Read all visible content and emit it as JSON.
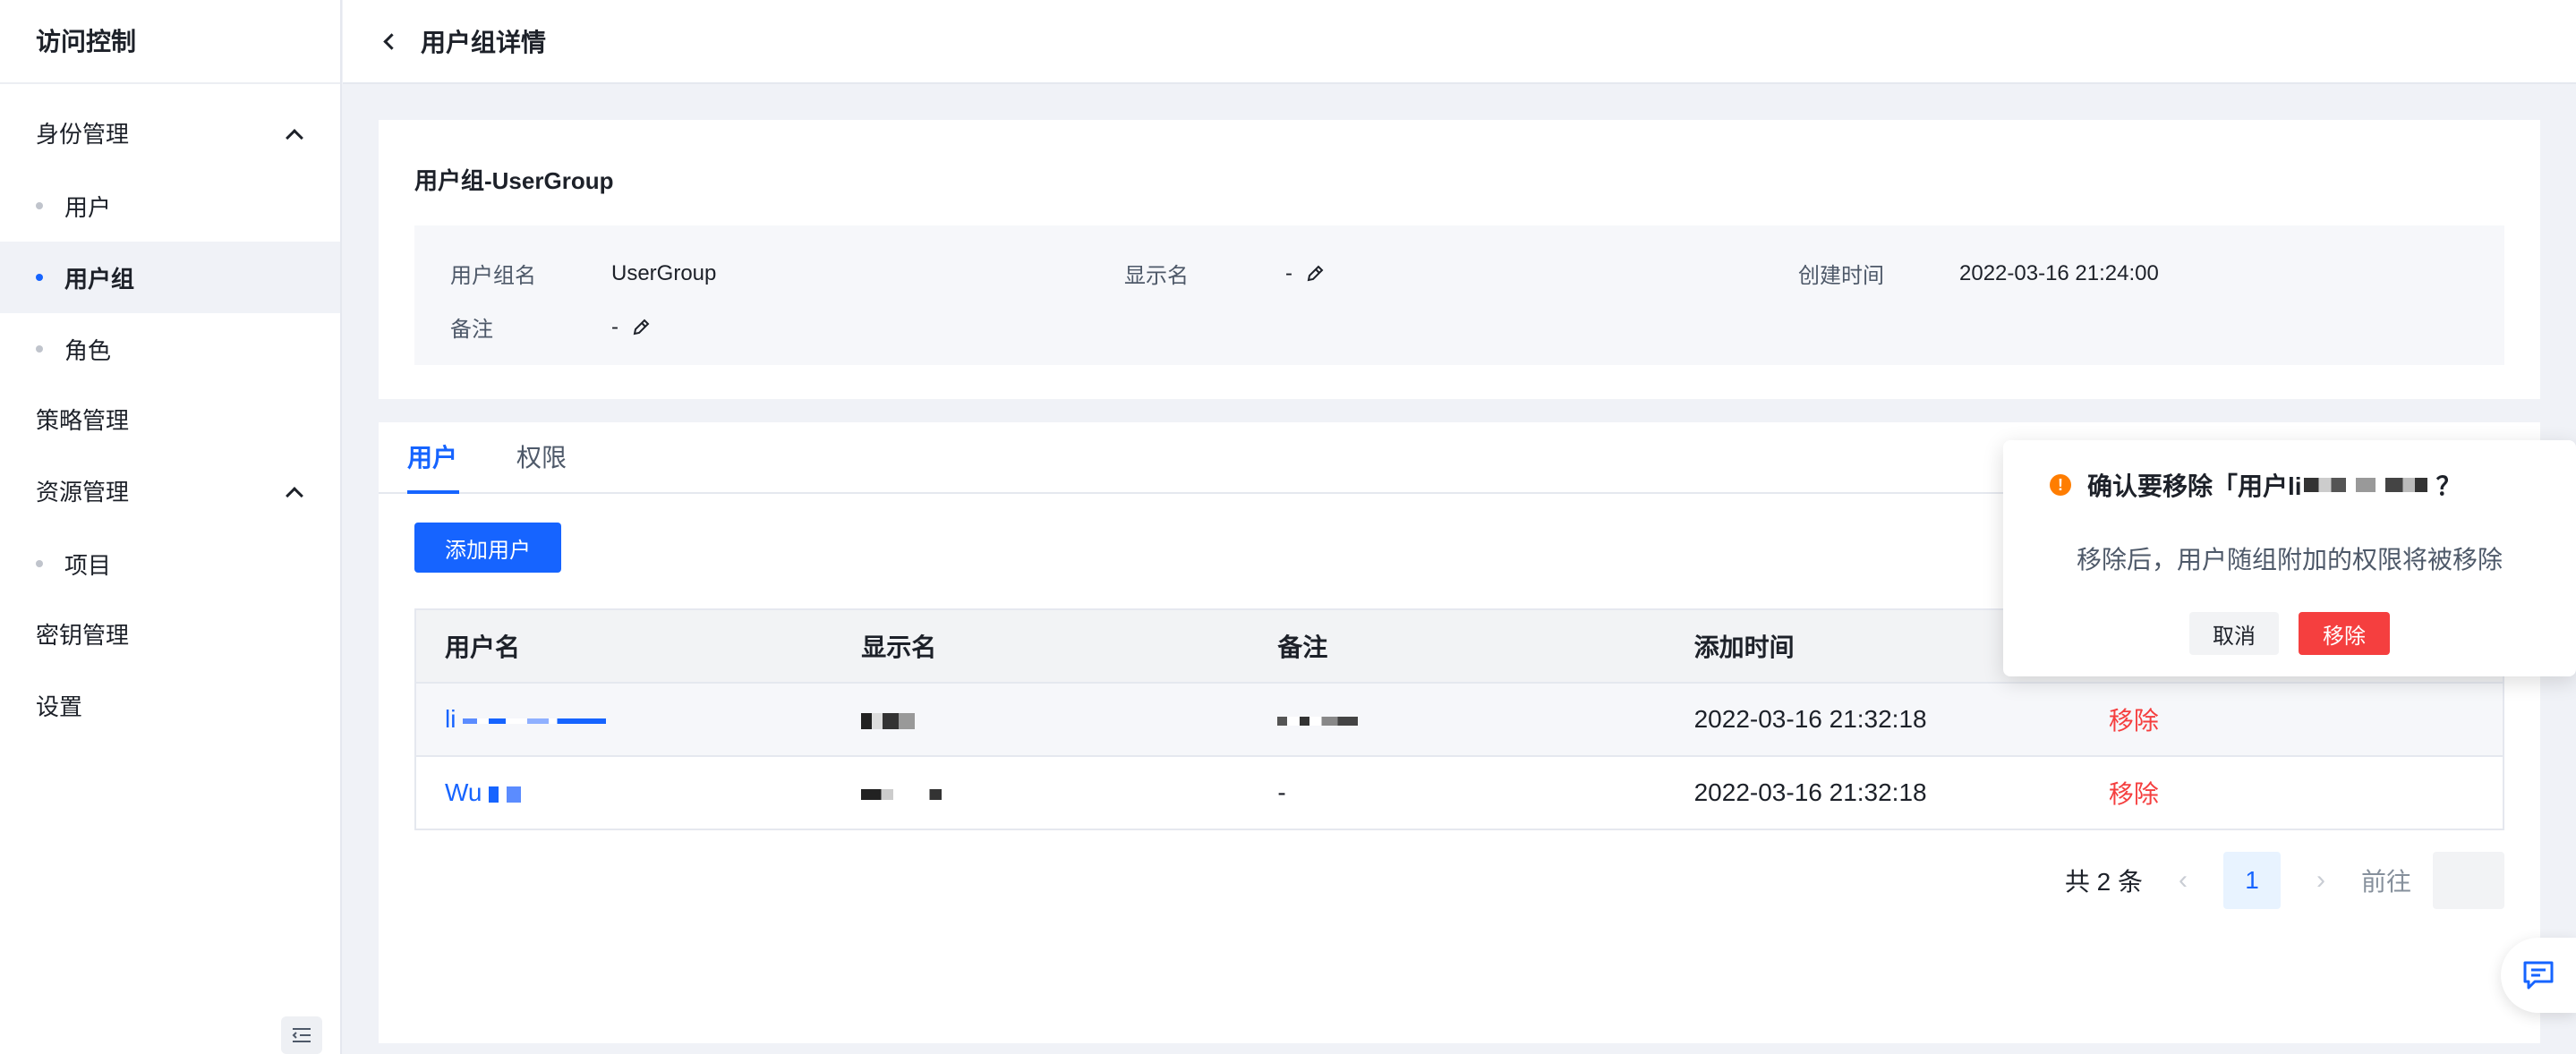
{
  "sidebar": {
    "title": "访问控制",
    "groups": [
      {
        "label": "身份管理"
      },
      {
        "label": "策略管理"
      },
      {
        "label": "资源管理"
      },
      {
        "label": "密钥管理"
      },
      {
        "label": "设置"
      }
    ],
    "identity_items": [
      {
        "label": "用户"
      },
      {
        "label": "用户组"
      },
      {
        "label": "角色"
      }
    ],
    "resource_items": [
      {
        "label": "项目"
      }
    ]
  },
  "header": {
    "title": "用户组详情"
  },
  "info": {
    "title": "用户组-UserGroup",
    "name_label": "用户组名",
    "name_value": "UserGroup",
    "display_label": "显示名",
    "display_value": "-",
    "created_label": "创建时间",
    "created_value": "2022-03-16 21:24:00",
    "remark_label": "备注",
    "remark_value": "-"
  },
  "tabs": [
    {
      "label": "用户",
      "active": true
    },
    {
      "label": "权限",
      "active": false
    }
  ],
  "add_user_label": "添加用户",
  "table": {
    "headers": [
      "用户名",
      "显示名",
      "备注",
      "添加时间",
      ""
    ],
    "rows": [
      {
        "username": "li",
        "display": "",
        "remark": "",
        "added": "2022-03-16 21:32:18",
        "action": "移除"
      },
      {
        "username": "Wu",
        "display": "",
        "remark": "-",
        "added": "2022-03-16 21:32:18",
        "action": "移除"
      }
    ]
  },
  "pagination": {
    "total": "共 2 条",
    "current": "1",
    "goto_label": "前往"
  },
  "popconfirm": {
    "title": "确认要移除「用户li",
    "title_end": "？",
    "body": "移除后，用户随组附加的权限将被移除",
    "cancel": "取消",
    "confirm": "移除"
  },
  "colors": {
    "primary": "#1664ff",
    "danger": "#f53f3f",
    "warning": "#ff7d00"
  }
}
